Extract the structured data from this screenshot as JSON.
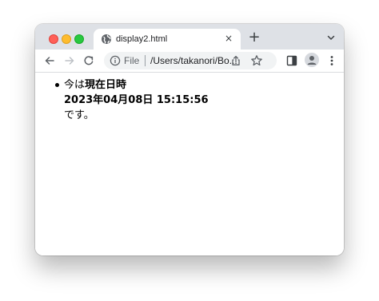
{
  "browser": {
    "tab": {
      "title": "display2.html",
      "close_glyph": "×"
    },
    "new_tab_glyph": "+",
    "omnibox": {
      "scheme_label": "File",
      "url": "/Users/takanori/Bo..."
    },
    "icons": {
      "favicon": "globe-icon",
      "tab_search": "chevron-down-icon",
      "back": "back-arrow-icon",
      "forward": "forward-arrow-icon",
      "reload": "reload-icon",
      "info": "info-icon",
      "share": "share-icon",
      "bookmark": "star-icon",
      "side_panel": "side-panel-icon",
      "profile": "profile-avatar-icon",
      "menu": "kebab-menu-icon"
    },
    "colors": {
      "tabstrip": "#dee1e6",
      "close_button": "#ff5f57",
      "minimize_button": "#febc2e",
      "zoom_button": "#28c840"
    }
  },
  "page": {
    "list_items": [
      {
        "prefix": "今は",
        "bold_label": "現在日時",
        "datetime": "2023年04月08日 15:15:56",
        "suffix": "です。"
      }
    ]
  }
}
